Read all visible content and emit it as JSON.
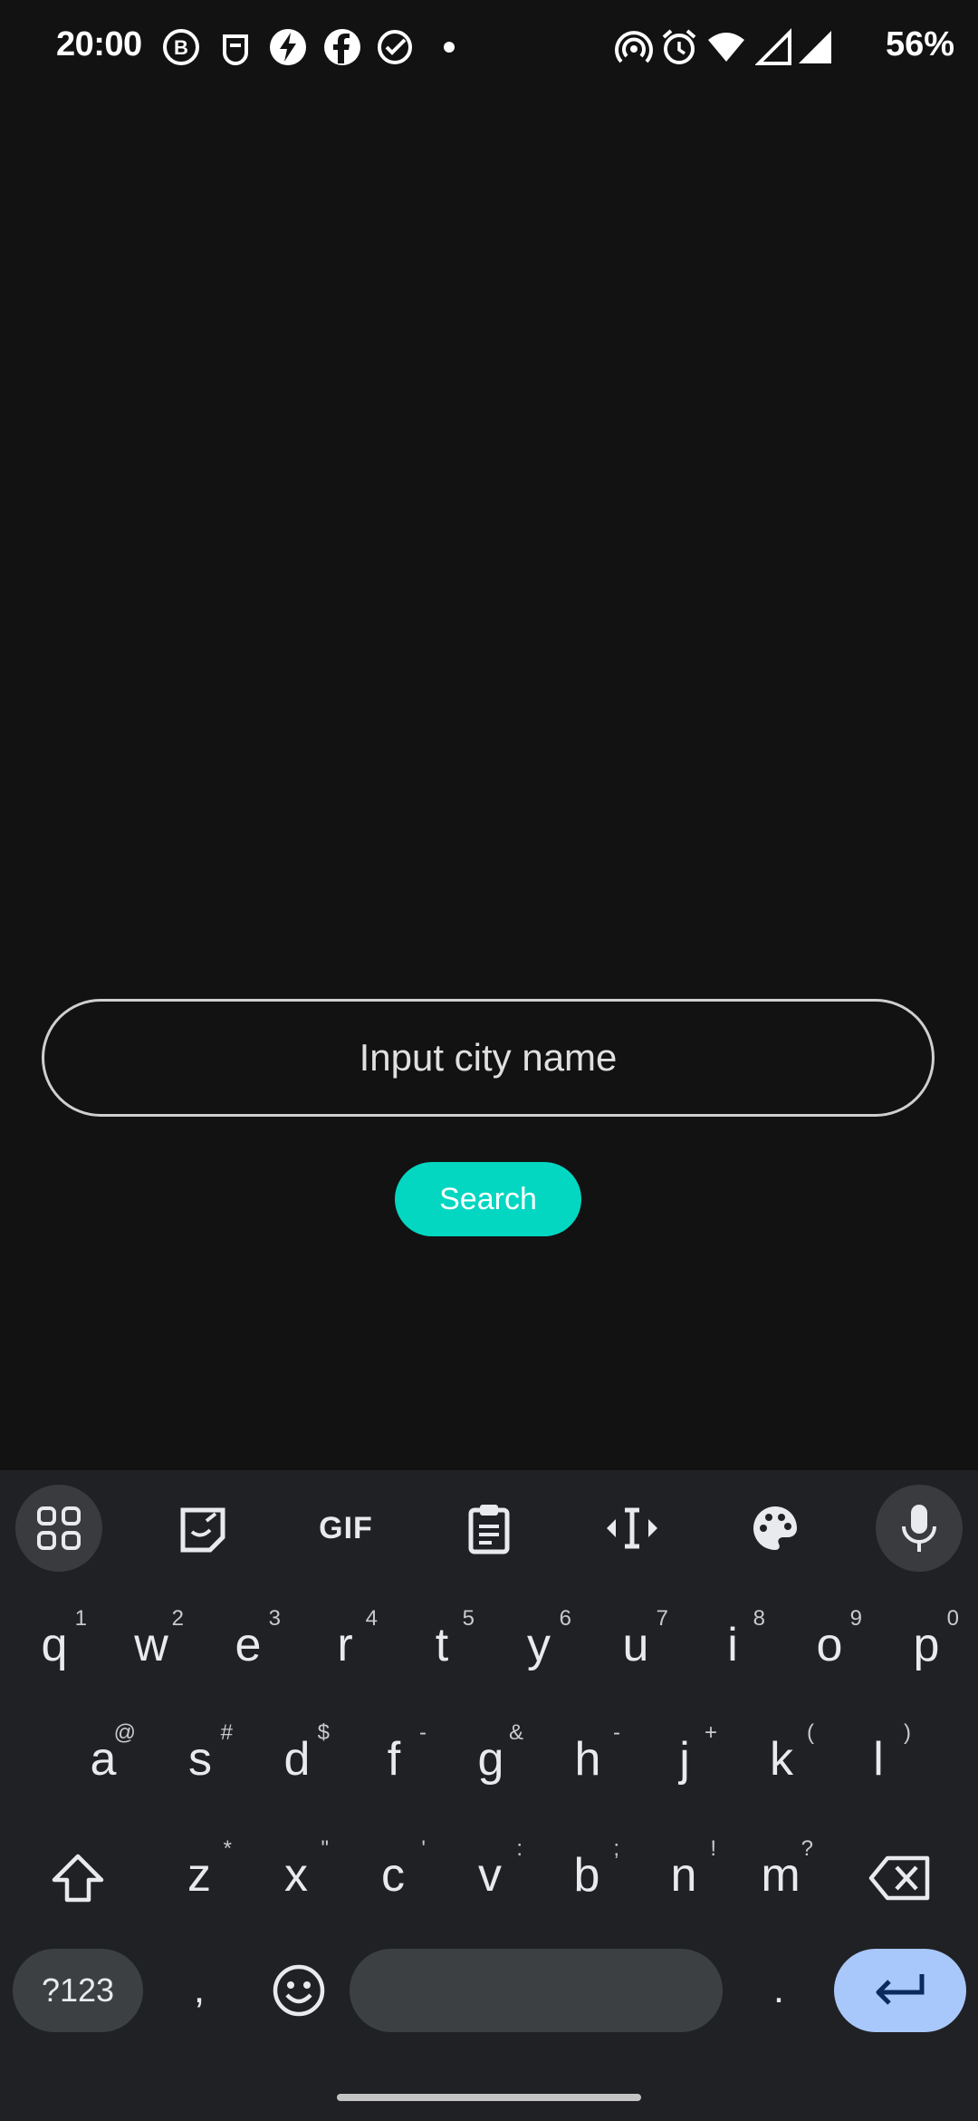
{
  "status_bar": {
    "time": "20:00",
    "battery": "56%",
    "left_icons": [
      "b-icon",
      "tea-icon",
      "bolt-icon",
      "facebook-icon",
      "check-circle-icon",
      "dot-icon"
    ],
    "right_icons": [
      "hotspot-icon",
      "alarm-icon",
      "wifi-icon",
      "signal-icon",
      "signal-icon"
    ]
  },
  "search": {
    "placeholder": "Input city name",
    "value": "",
    "button_label": "Search",
    "accent": "#03d7c1"
  },
  "keyboard": {
    "toolbar": [
      "apps-icon",
      "sticker-icon",
      "GIF",
      "clipboard-icon",
      "cursor-icon",
      "palette-icon",
      "mic-icon"
    ],
    "row1": [
      {
        "k": "q",
        "h": "1"
      },
      {
        "k": "w",
        "h": "2"
      },
      {
        "k": "e",
        "h": "3"
      },
      {
        "k": "r",
        "h": "4"
      },
      {
        "k": "t",
        "h": "5"
      },
      {
        "k": "y",
        "h": "6"
      },
      {
        "k": "u",
        "h": "7"
      },
      {
        "k": "i",
        "h": "8"
      },
      {
        "k": "o",
        "h": "9"
      },
      {
        "k": "p",
        "h": "0"
      }
    ],
    "row2": [
      {
        "k": "a",
        "h": "@"
      },
      {
        "k": "s",
        "h": "#"
      },
      {
        "k": "d",
        "h": "$"
      },
      {
        "k": "f",
        "h": "-"
      },
      {
        "k": "g",
        "h": "&"
      },
      {
        "k": "h",
        "h": "-"
      },
      {
        "k": "j",
        "h": "+"
      },
      {
        "k": "k",
        "h": "("
      },
      {
        "k": "l",
        "h": ")"
      }
    ],
    "row3": [
      {
        "k": "z",
        "h": "*"
      },
      {
        "k": "x",
        "h": "\""
      },
      {
        "k": "c",
        "h": "'"
      },
      {
        "k": "v",
        "h": ":"
      },
      {
        "k": "b",
        "h": ";"
      },
      {
        "k": "n",
        "h": "!"
      },
      {
        "k": "m",
        "h": "?"
      }
    ],
    "symbols_label": "?123",
    "comma": ",",
    "period": "."
  }
}
